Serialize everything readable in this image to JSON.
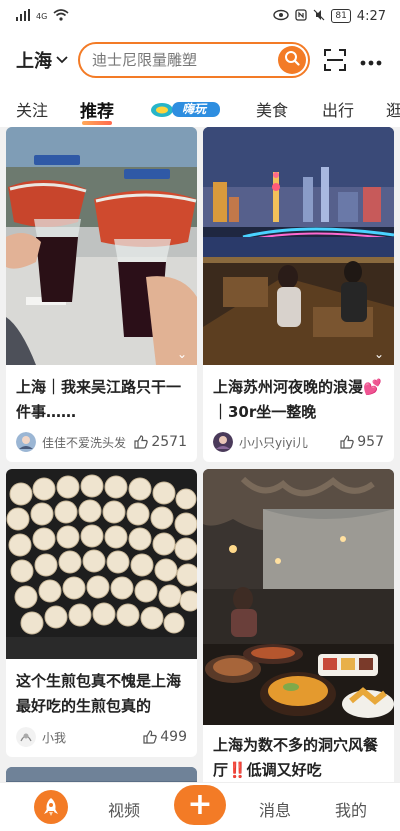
{
  "status_bar": {
    "signal_text": "4G",
    "battery": "81",
    "time": "4:27"
  },
  "header": {
    "city": "上海",
    "search_placeholder": "迪士尼限量雕塑"
  },
  "tabs": [
    "关注",
    "推荐",
    "美食",
    "出行",
    "逛"
  ],
  "tab_logo_text": "嗨玩",
  "feed": [
    {
      "title": "上海｜我来吴江路只干一件事……",
      "author": "佳佳不爱洗头发",
      "likes": "2571"
    },
    {
      "title": "上海苏州河夜晚的浪漫💕｜30r坐一整晚",
      "author": "小小只yiyi儿",
      "likes": "957"
    },
    {
      "title": "这个生煎包真不愧是上海最好吃的生煎包真的",
      "author": "小我",
      "likes": "499"
    },
    {
      "title": "上海为数不多的洞穴风餐厅‼️低调又好吃",
      "author": "",
      "likes": ""
    }
  ],
  "bottom_nav": {
    "video": "视频",
    "messages": "消息",
    "mine": "我的",
    "plus": "+"
  },
  "colors": {
    "accent": "#f37b26"
  }
}
